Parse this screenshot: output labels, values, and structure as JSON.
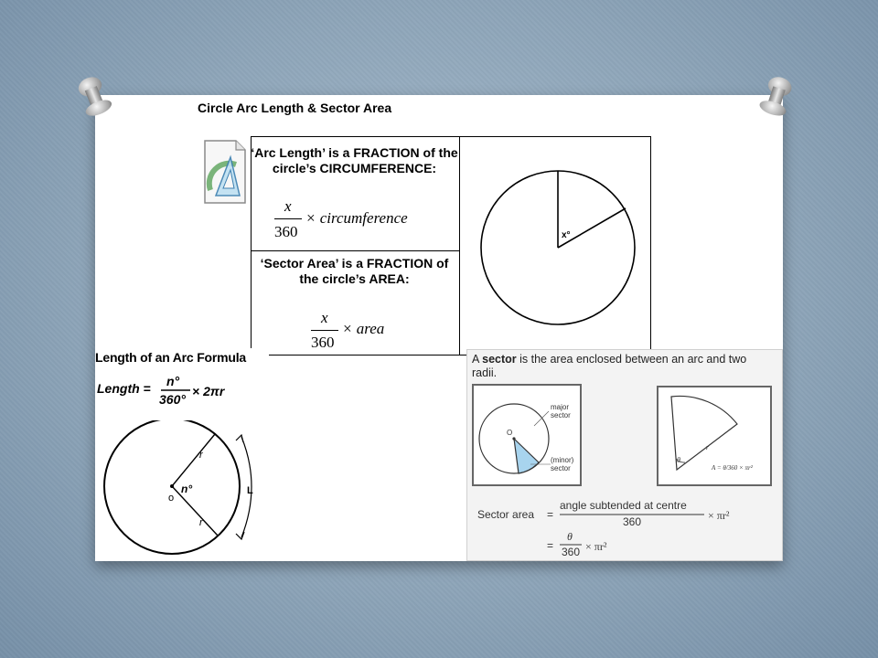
{
  "doc": {
    "title": "Circle Arc Length & Sector Area",
    "arc_text": "‘Arc Length’ is a FRACTION of the circle’s CIRCUMFERENCE:",
    "arc_num": "x",
    "arc_den": "360",
    "arc_mult": "× circumference",
    "sector_text": "‘Sector Area’ is a FRACTION of the circle’s AREA:",
    "sector_num": "x",
    "sector_den": "360",
    "sector_mult": "× area",
    "angle_label": "x°"
  },
  "arc_formula": {
    "title": "Length of an Arc Formula",
    "formula_lhs": "Length =",
    "formula_num": "n°",
    "formula_den": "360°",
    "formula_rhs": "× 2πr",
    "center_label": "o",
    "angle_label": "n°",
    "radius_label": "r",
    "arc_label": "L"
  },
  "sector_def": {
    "sentence_pre": "A ",
    "sentence_bold": "sector",
    "sentence_post": " is the area enclosed between an arc and two radii.",
    "major_label": "major sector",
    "minor_label": "(minor) sector",
    "center_label": "O",
    "theta": "θ",
    "radius": "r",
    "small_formula": "A = θ/360 × πr²",
    "area_label": "Sector area",
    "area_eq": "=",
    "area_num": "angle subtended at centre",
    "area_den": "360",
    "area_rhs": "× πr²",
    "area2_num": "θ",
    "area2_den": "360",
    "area2_rhs": "× πr²"
  },
  "colors": {
    "background": "#8ea5b9",
    "minor_sector": "#a8d4ee"
  }
}
